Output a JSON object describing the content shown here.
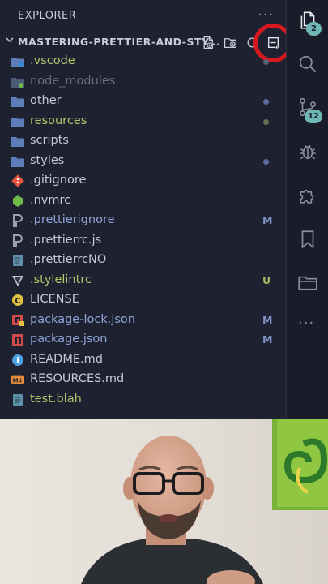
{
  "explorer": {
    "header": "EXPLORER",
    "more": "···",
    "folder_name": "MASTERING-PRETTIER-AND-STY...",
    "toolbar": [
      "new-file-icon",
      "new-folder-icon",
      "refresh-icon",
      "collapse-all-icon"
    ]
  },
  "files": [
    {
      "label": ".vscode",
      "kind": "folder-vscode",
      "color": "green",
      "marker": "dot",
      "marker_color": "#5a6072"
    },
    {
      "label": "node_modules",
      "kind": "folder-node",
      "color": "dim",
      "marker": "",
      "marker_color": ""
    },
    {
      "label": "other",
      "kind": "folder",
      "color": "default",
      "marker": "dot",
      "marker_color": "#5d6ba0"
    },
    {
      "label": "resources",
      "kind": "folder",
      "color": "green",
      "marker": "dot",
      "marker_color": "#6a7250"
    },
    {
      "label": "scripts",
      "kind": "folder",
      "color": "default",
      "marker": "",
      "marker_color": ""
    },
    {
      "label": "styles",
      "kind": "folder",
      "color": "default",
      "marker": "dot",
      "marker_color": "#5d6ba0"
    },
    {
      "label": ".gitignore",
      "kind": "git",
      "color": "default",
      "marker": "",
      "marker_color": ""
    },
    {
      "label": ".nvmrc",
      "kind": "node",
      "color": "default",
      "marker": "",
      "marker_color": ""
    },
    {
      "label": ".prettierignore",
      "kind": "prettier",
      "color": "blue",
      "marker": "M",
      "marker_color": "#7f93c8"
    },
    {
      "label": ".prettierrc.js",
      "kind": "prettier",
      "color": "default",
      "marker": "",
      "marker_color": ""
    },
    {
      "label": ".prettierrcNO",
      "kind": "file-generic",
      "color": "default",
      "marker": "",
      "marker_color": ""
    },
    {
      "label": ".stylelintrc",
      "kind": "stylelint",
      "color": "green",
      "marker": "U",
      "marker_color": "#a9b565"
    },
    {
      "label": "LICENSE",
      "kind": "license",
      "color": "default",
      "marker": "",
      "marker_color": ""
    },
    {
      "label": "package-lock.json",
      "kind": "npm-lock",
      "color": "blue",
      "marker": "M",
      "marker_color": "#7f93c8"
    },
    {
      "label": "package.json",
      "kind": "npm",
      "color": "blue",
      "marker": "M",
      "marker_color": "#7f93c8"
    },
    {
      "label": "README.md",
      "kind": "info",
      "color": "default",
      "marker": "",
      "marker_color": ""
    },
    {
      "label": "RESOURCES.md",
      "kind": "markdown",
      "color": "default",
      "marker": "",
      "marker_color": ""
    },
    {
      "label": "test.blah",
      "kind": "file-generic",
      "color": "green",
      "marker": "",
      "marker_color": ""
    }
  ],
  "activity_bar": {
    "explorer_badge": "2",
    "source_control_badge": "12",
    "more": "···",
    "items": [
      "files-icon",
      "search-icon",
      "source-control-icon",
      "debug-icon",
      "extensions-icon",
      "bookmark-icon",
      "folder-icon"
    ]
  },
  "colors": {
    "accent_teal": "#6fb7b4",
    "highlight_red": "#d7191f",
    "modified_blue": "#7f93c8",
    "untracked_green": "#b4c46a"
  }
}
